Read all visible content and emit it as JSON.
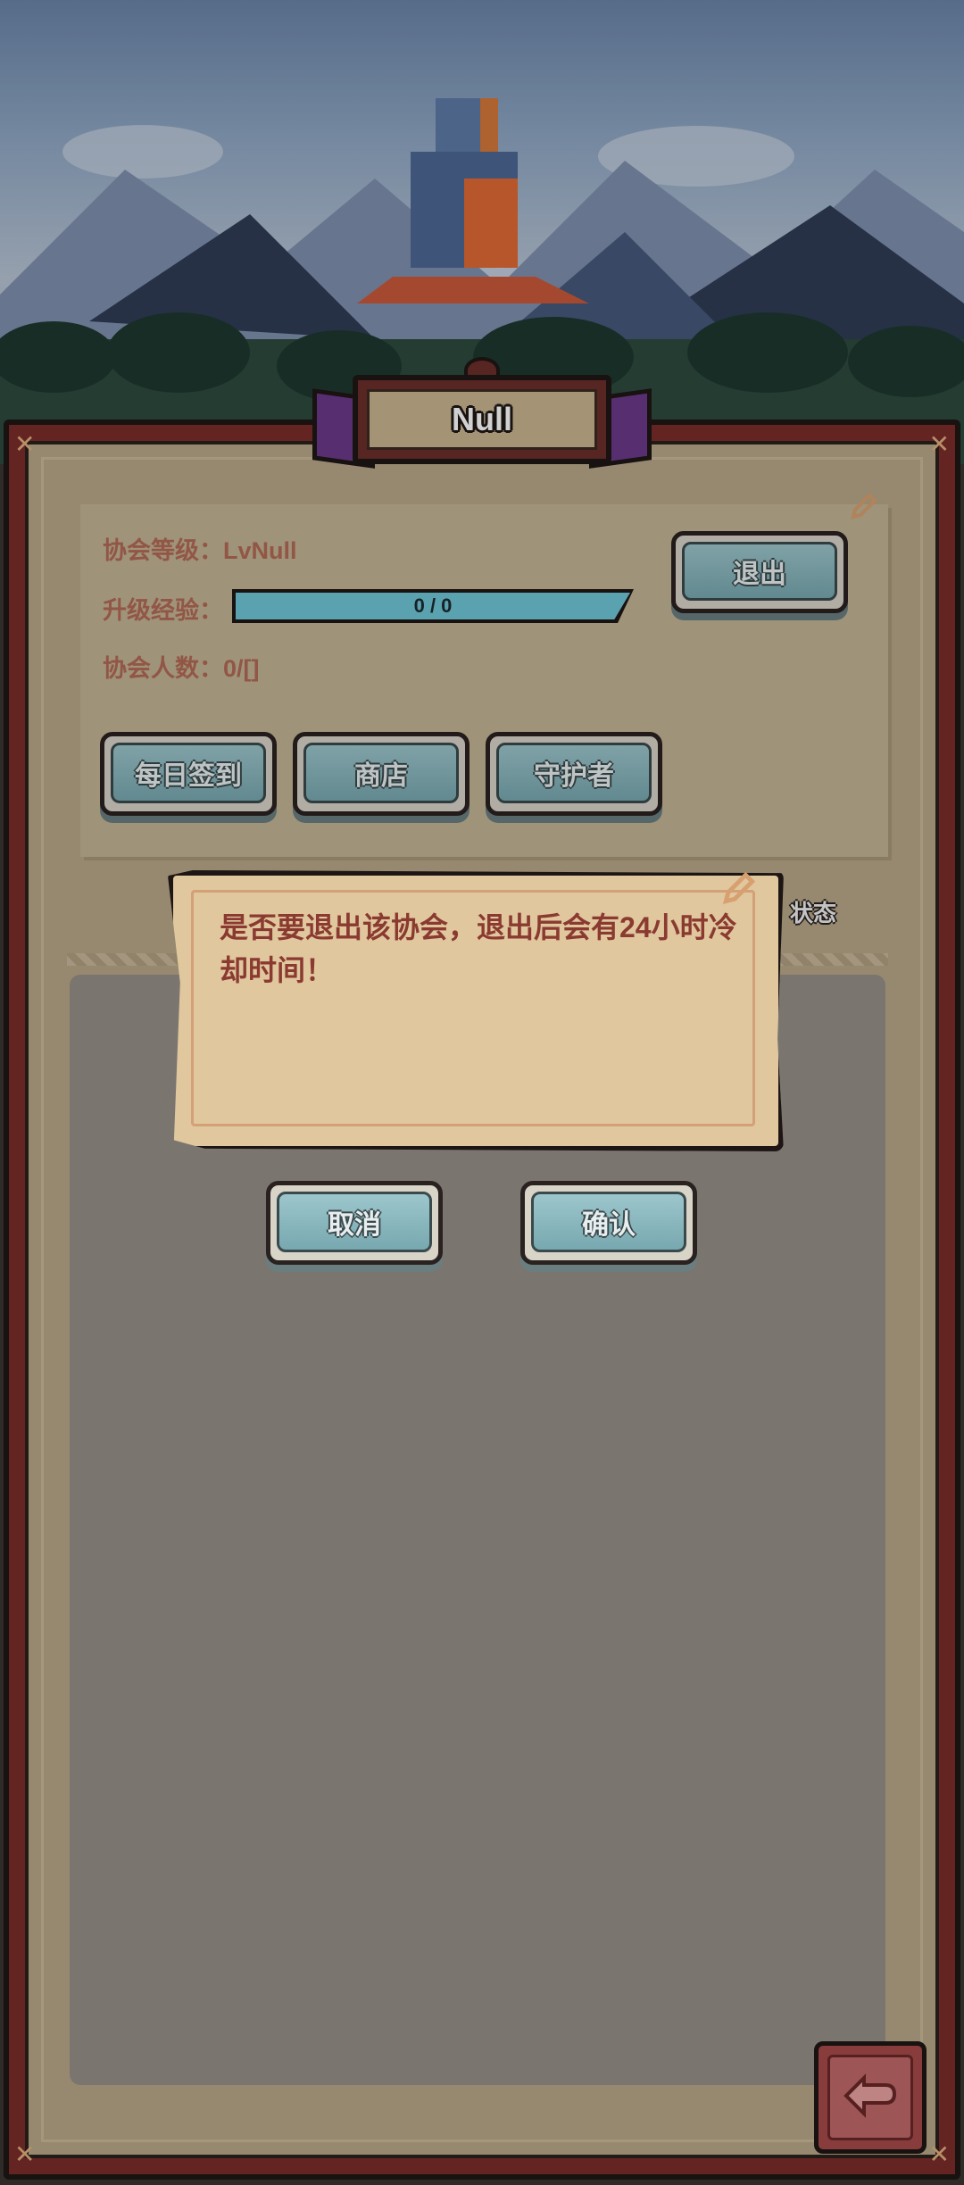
{
  "guild": {
    "name": "Null",
    "level_label": "协会等级：",
    "level_value": "LvNull",
    "xp_label": "升级经验：",
    "xp_text": "0 / 0",
    "xp_progress": 1.0,
    "members_label": "协会人数：",
    "members_value": "0/[]"
  },
  "buttons": {
    "quit": "退出",
    "daily_checkin": "每日签到",
    "shop": "商店",
    "guardian": "守护者"
  },
  "list": {
    "status_header": "状态"
  },
  "dialog": {
    "message": "是否要退出该协会，退出后会有24小时冷却时间！",
    "cancel": "取消",
    "confirm": "确认"
  },
  "icons": {
    "back": "back-arrow-icon",
    "edit": "pencil-icon"
  },
  "colors": {
    "label_text": "#b26a56",
    "button_fill": "#8ab8c0",
    "xp_fill": "#6ec6d6",
    "dialog_text": "#8a3a30",
    "frame": "#7a2e2a"
  }
}
